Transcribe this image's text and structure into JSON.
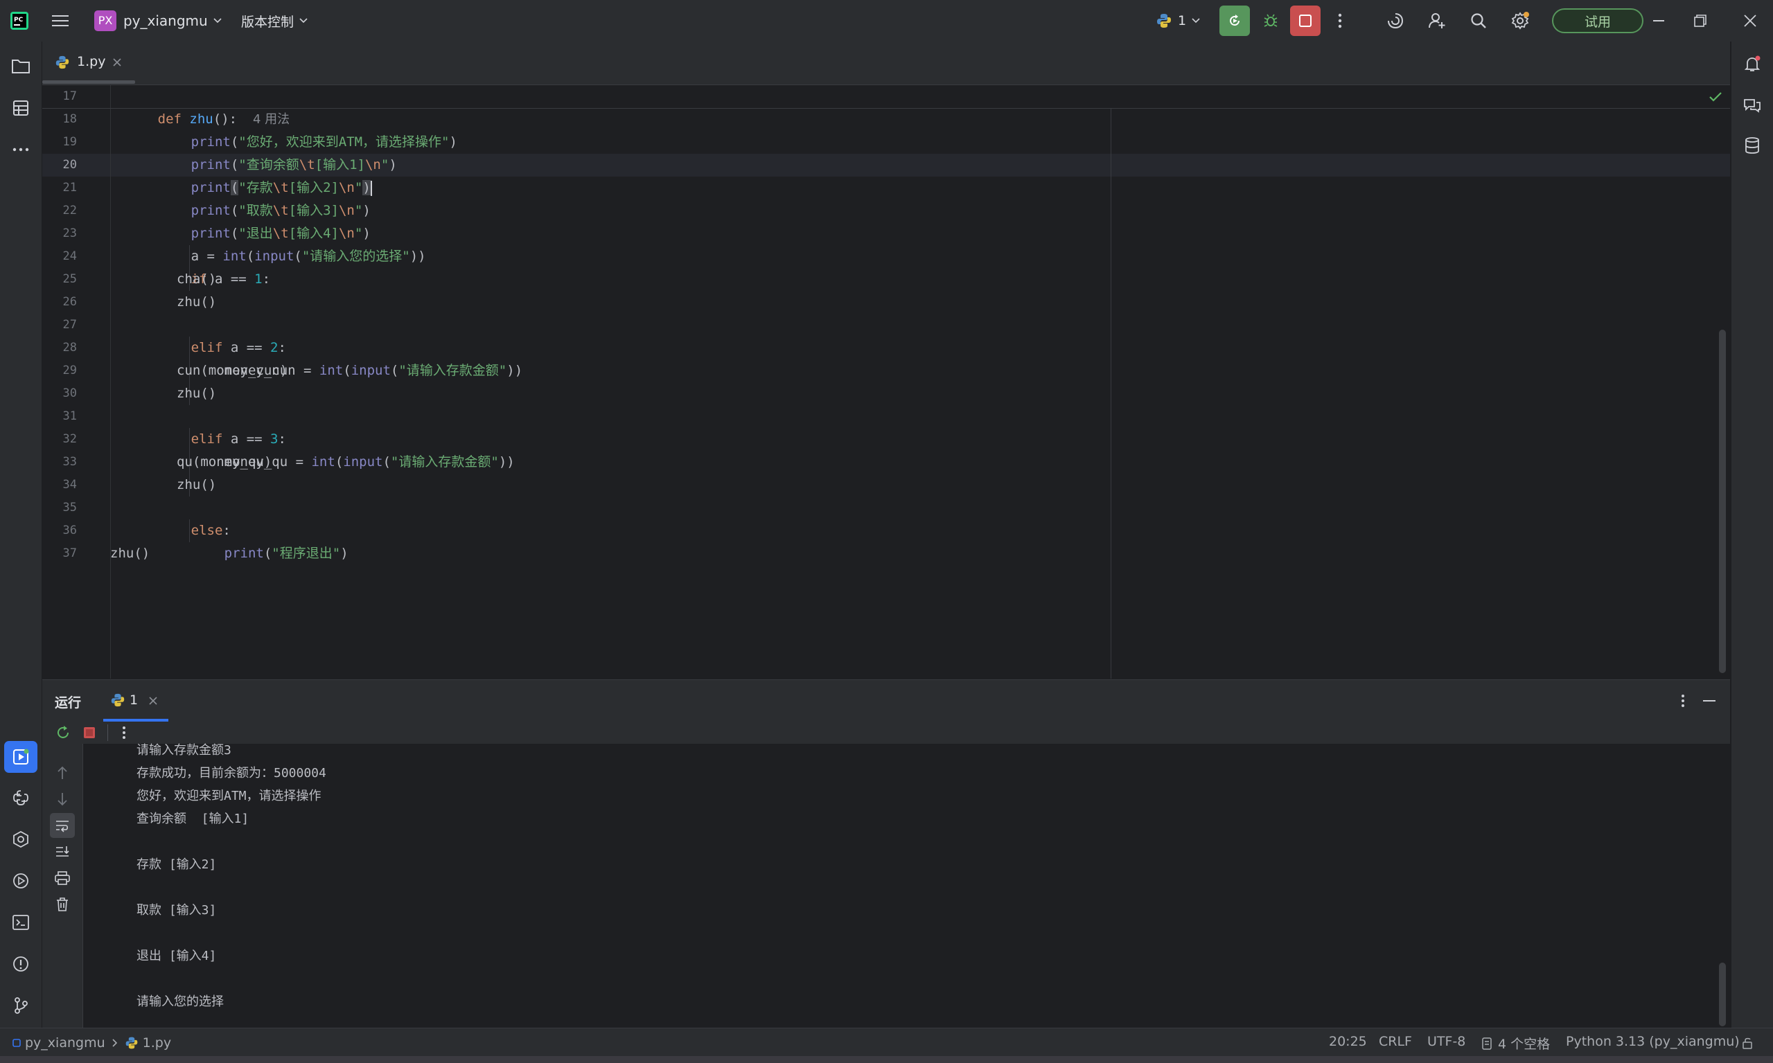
{
  "titlebar": {
    "project_badge": "PX",
    "project_name": "py_xiangmu",
    "vcs_label": "版本控制",
    "run_config_count": "1",
    "trial_label": "试用"
  },
  "editor_tab": {
    "file_name": "1.py"
  },
  "editor": {
    "line_numbers": [
      "17",
      "18",
      "19",
      "20",
      "21",
      "22",
      "23",
      "24",
      "25",
      "26",
      "27",
      "28",
      "29",
      "30",
      "31",
      "32",
      "33",
      "34",
      "35",
      "36",
      "37"
    ],
    "current_line": "20",
    "code": {
      "l17": {
        "def": "def",
        "name": "zhu",
        "paren": "():",
        "hint": "4 用法"
      },
      "l18": {
        "fn": "print",
        "open": "(",
        "str": "\"您好，欢迎来到ATM，请选择操作\"",
        "close": ")"
      },
      "l19": {
        "fn": "print",
        "open": "(",
        "s1": "\"查询余额",
        "e1": "\\t",
        "s2": "[输入1]",
        "e2": "\\n",
        "s3": "\"",
        "close": ")"
      },
      "l20": {
        "fn": "print",
        "open": "(",
        "s1": "\"存款",
        "e1": "\\t",
        "s2": "[输入2]",
        "e2": "\\n",
        "s3": "\"",
        "close": ")"
      },
      "l21": {
        "fn": "print",
        "open": "(",
        "s1": "\"取款",
        "e1": "\\t",
        "s2": "[输入3]",
        "e2": "\\n",
        "s3": "\"",
        "close": ")"
      },
      "l22": {
        "fn": "print",
        "open": "(",
        "s1": "\"退出",
        "e1": "\\t",
        "s2": "[输入4]",
        "e2": "\\n",
        "s3": "\"",
        "close": ")"
      },
      "l23": {
        "pre": "a = ",
        "int": "int",
        "p1": "(",
        "input": "input",
        "p2": "(",
        "str": "\"请输入您的选择\"",
        "close": "))"
      },
      "l24": {
        "kw": "if",
        "mid": " a == ",
        "num": "1",
        "end": ":"
      },
      "l25": {
        "text": "cha()"
      },
      "l26": {
        "text": "zhu()"
      },
      "l27": {
        "kw": "elif",
        "mid": " a == ",
        "num": "2",
        "end": ":"
      },
      "l28": {
        "pre": "money_cun = ",
        "int": "int",
        "p1": "(",
        "input": "input",
        "p2": "(",
        "str": "\"请输入存款金额\"",
        "close": "))"
      },
      "l29": {
        "text": "cun(money_cun)"
      },
      "l30": {
        "text": "zhu()"
      },
      "l31": {
        "kw": "elif",
        "mid": " a == ",
        "num": "3",
        "end": ":"
      },
      "l32": {
        "pre": "money_qu = ",
        "int": "int",
        "p1": "(",
        "input": "input",
        "p2": "(",
        "str": "\"请输入存款金额\"",
        "close": "))"
      },
      "l33": {
        "text": "qu(money_qu)"
      },
      "l34": {
        "text": "zhu()"
      },
      "l35": {
        "kw": "else",
        "end": ":"
      },
      "l36": {
        "fn": "print",
        "open": "(",
        "str": "\"程序退出\"",
        "close": ")"
      },
      "l37": {
        "text": "zhu()"
      }
    }
  },
  "run_panel": {
    "title": "运行",
    "tab_label": "1",
    "console_lines": [
      "请输入存款金额3",
      "存款成功，目前余额为：5000004",
      "您好，欢迎来到ATM，请选择操作",
      "查询余额  [输入1]",
      "",
      "存款 [输入2]",
      "",
      "取款 [输入3]",
      "",
      "退出 [输入4]",
      "",
      "请输入您的选择"
    ]
  },
  "statusbar": {
    "breadcrumb_project": "py_xiangmu",
    "breadcrumb_file": "1.py",
    "position": "20:25",
    "line_ending": "CRLF",
    "encoding": "UTF-8",
    "indent": "4 个空格",
    "interpreter": "Python 3.13 (py_xiangmu)"
  },
  "colors": {
    "accent": "#3574f0",
    "run_green": "#57965c",
    "stop_red": "#c94f4f",
    "trial_green": "#57965c"
  }
}
